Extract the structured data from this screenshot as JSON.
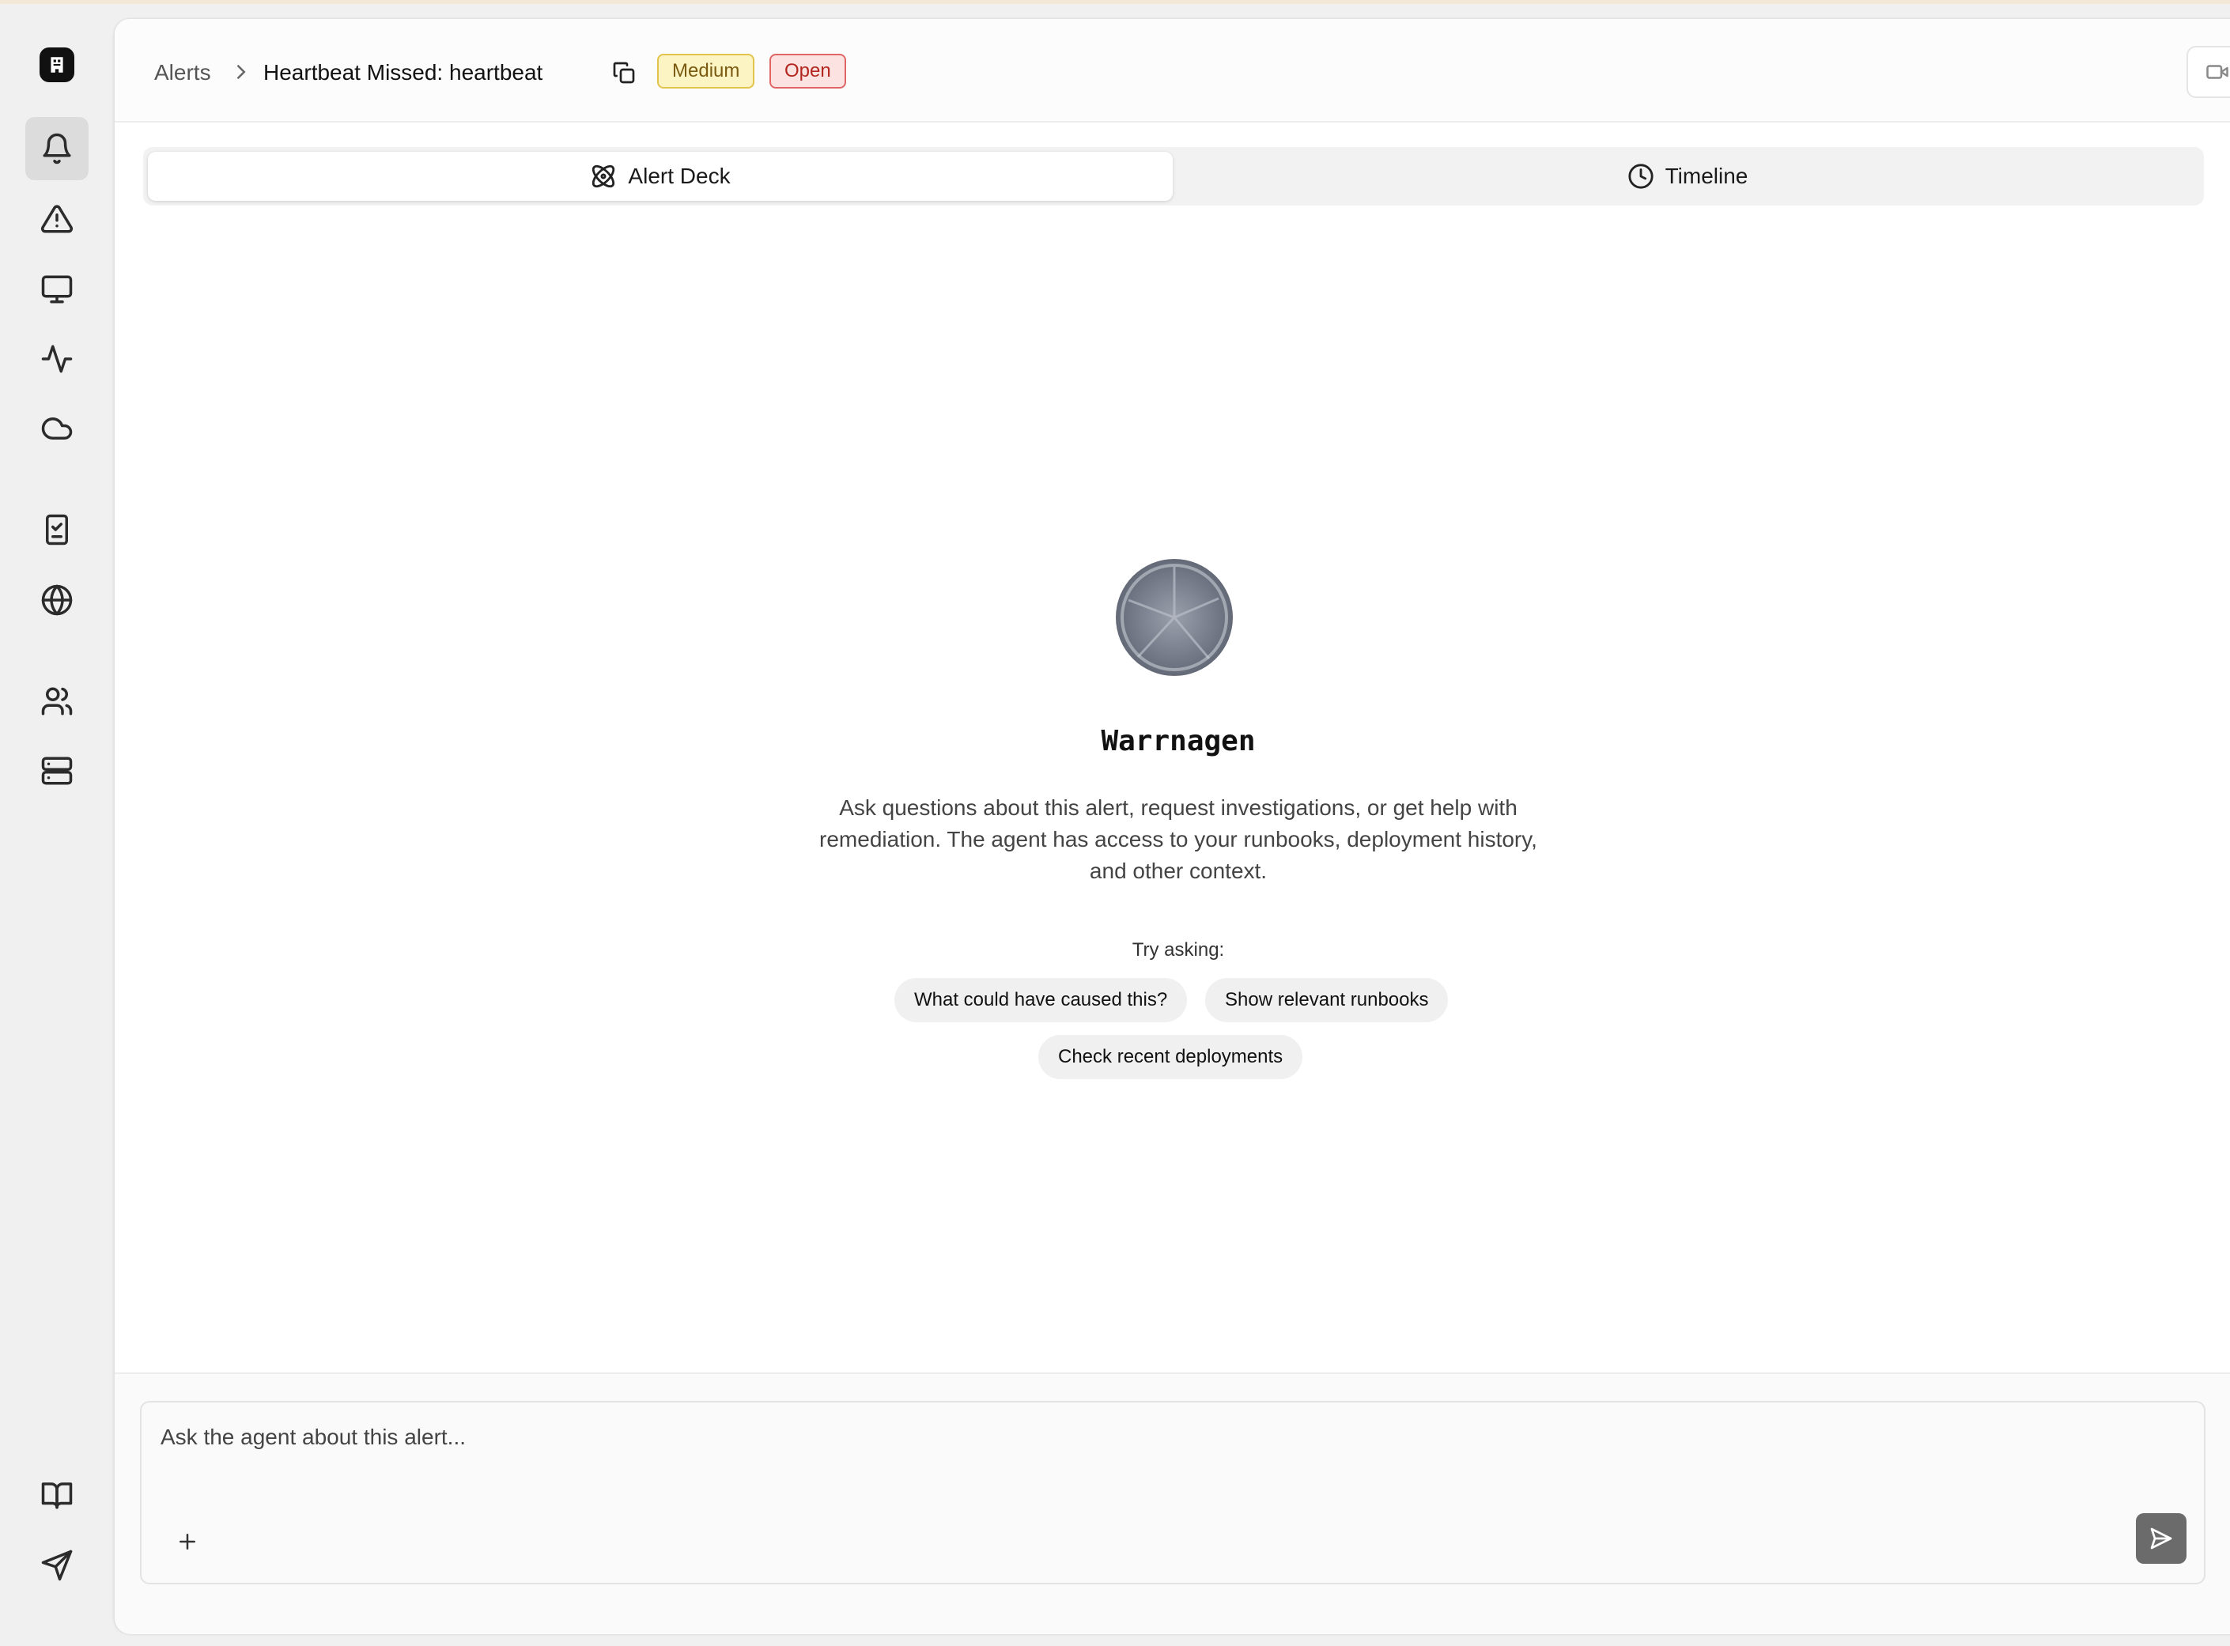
{
  "sidebar": {
    "logo_icon": "building-icon",
    "items": [
      {
        "icon": "bell-icon",
        "active": true
      },
      {
        "icon": "warning-triangle-icon"
      },
      {
        "icon": "monitor-icon"
      },
      {
        "icon": "activity-pulse-icon"
      },
      {
        "icon": "cloud-icon"
      },
      {
        "icon": "checklist-book-icon"
      },
      {
        "icon": "globe-icon"
      },
      {
        "icon": "users-icon"
      },
      {
        "icon": "server-icon"
      }
    ],
    "bottom_items": [
      {
        "icon": "open-book-icon"
      },
      {
        "icon": "send-paper-plane-icon"
      }
    ]
  },
  "header": {
    "breadcrumb_root": "Alerts",
    "title": "Heartbeat Missed: heartbeat",
    "severity_badge": "Medium",
    "status_badge": "Open"
  },
  "tabs": [
    {
      "label": "Alert Deck",
      "icon": "atom-icon",
      "active": true
    },
    {
      "label": "Timeline",
      "icon": "clock-icon",
      "active": false
    }
  ],
  "agent": {
    "name": "Warrnagen",
    "description": "Ask questions about this alert, request investigations, or get help with remediation. The agent has access to your runbooks, deployment history, and other context.",
    "try_label": "Try asking:",
    "suggestions": [
      "What could have caused this?",
      "Show relevant runbooks",
      "Check recent deployments"
    ]
  },
  "composer": {
    "placeholder": "Ask the agent about this alert...",
    "value": ""
  },
  "colors": {
    "badge_medium_bg": "#fdf4c4",
    "badge_medium_border": "#e2c34b",
    "badge_open_bg": "#fde2e2",
    "badge_open_border": "#e06666",
    "send_button": "#6b6b6b"
  }
}
